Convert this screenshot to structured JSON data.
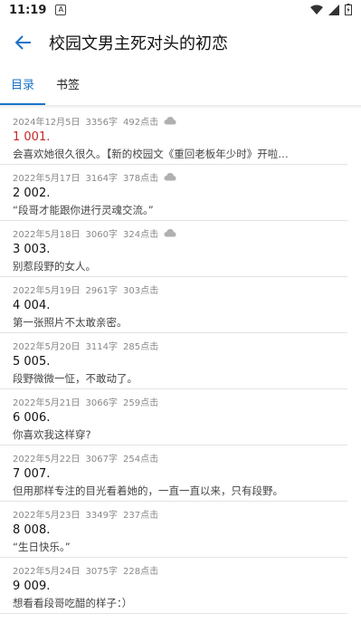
{
  "status_bar": {
    "time": "11:19",
    "notification_glyph": "A"
  },
  "app_bar": {
    "title": "校园文男主死对头的初恋"
  },
  "tabs": [
    {
      "label": "目录",
      "active": true
    },
    {
      "label": "书签",
      "active": false
    }
  ],
  "colors": {
    "accent": "#1a73c8",
    "current_chapter": "#c62828"
  },
  "chapters": [
    {
      "date": "2024年12月5日",
      "words": "3356字",
      "clicks": "492点击",
      "cloud": true,
      "title": "1 001.",
      "desc": "会喜欢她很久很久。【新的校园文《重回老板年少时》开啦…",
      "current": true
    },
    {
      "date": "2022年5月17日",
      "words": "3164字",
      "clicks": "378点击",
      "cloud": true,
      "title": "2 002.",
      "desc": "“段哥才能跟你进行灵魂交流。”",
      "current": false
    },
    {
      "date": "2022年5月18日",
      "words": "3060字",
      "clicks": "324点击",
      "cloud": true,
      "title": "3 003.",
      "desc": "别惹段野的女人。",
      "current": false
    },
    {
      "date": "2022年5月19日",
      "words": "2961字",
      "clicks": "303点击",
      "cloud": false,
      "title": "4 004.",
      "desc": "第一张照片不太敢亲密。",
      "current": false
    },
    {
      "date": "2022年5月20日",
      "words": "3114字",
      "clicks": "285点击",
      "cloud": false,
      "title": "5 005.",
      "desc": "段野微微一怔，不敢动了。",
      "current": false
    },
    {
      "date": "2022年5月21日",
      "words": "3066字",
      "clicks": "259点击",
      "cloud": false,
      "title": "6 006.",
      "desc": "你喜欢我这样穿?",
      "current": false
    },
    {
      "date": "2022年5月22日",
      "words": "3067字",
      "clicks": "254点击",
      "cloud": false,
      "title": "7 007.",
      "desc": "但用那样专注的目光看着她的，一直一直以来，只有段野。",
      "current": false
    },
    {
      "date": "2022年5月23日",
      "words": "3349字",
      "clicks": "237点击",
      "cloud": false,
      "title": "8 008.",
      "desc": "“生日快乐。”",
      "current": false
    },
    {
      "date": "2022年5月24日",
      "words": "3075字",
      "clicks": "228点击",
      "cloud": false,
      "title": "9 009.",
      "desc": "想看看段哥吃醋的样子：）",
      "current": false
    }
  ]
}
